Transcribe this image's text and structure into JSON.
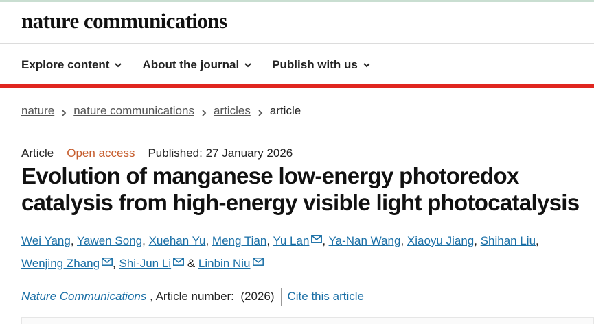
{
  "brand": "nature communications",
  "nav": {
    "items": [
      {
        "label": "Explore content"
      },
      {
        "label": "About the journal"
      },
      {
        "label": "Publish with us"
      }
    ]
  },
  "breadcrumb": {
    "links": [
      "nature",
      "nature communications",
      "articles"
    ],
    "current": "article"
  },
  "meta": {
    "type": "Article",
    "access": "Open access",
    "published": "Published: 27 January 2026"
  },
  "title": {
    "line1": "Evolution of manganese low-energy photoredox",
    "line2": "catalysis from high-energy visible light photocatalysis"
  },
  "authors": {
    "list": [
      {
        "name": "Wei Yang",
        "corresponding": false
      },
      {
        "name": "Yawen Song",
        "corresponding": false
      },
      {
        "name": "Xuehan Yu",
        "corresponding": false
      },
      {
        "name": "Meng Tian",
        "corresponding": false
      },
      {
        "name": "Yu Lan",
        "corresponding": true
      },
      {
        "name": "Ya-Nan Wang",
        "corresponding": false
      },
      {
        "name": "Xiaoyu Jiang",
        "corresponding": false
      },
      {
        "name": "Shihan Liu",
        "corresponding": false
      },
      {
        "name": "Wenjing Zhang",
        "corresponding": true
      },
      {
        "name": "Shi-Jun Li",
        "corresponding": true
      },
      {
        "name": "Linbin Niu",
        "corresponding": true
      }
    ],
    "separator": ", ",
    "last_separator": " & "
  },
  "journal_line": {
    "journal": "Nature Communications",
    "article_number": " , Article number:  (2026)",
    "cite": "Cite this article"
  },
  "colors": {
    "link": "#1a6fa6",
    "accent_red": "#e0261f",
    "open_access": "#c55c2c"
  },
  "icons": {
    "nav_chevron": "chevron-down-icon",
    "breadcrumb_separator": "chevron-right-icon",
    "corresponding_author": "mail-icon"
  }
}
